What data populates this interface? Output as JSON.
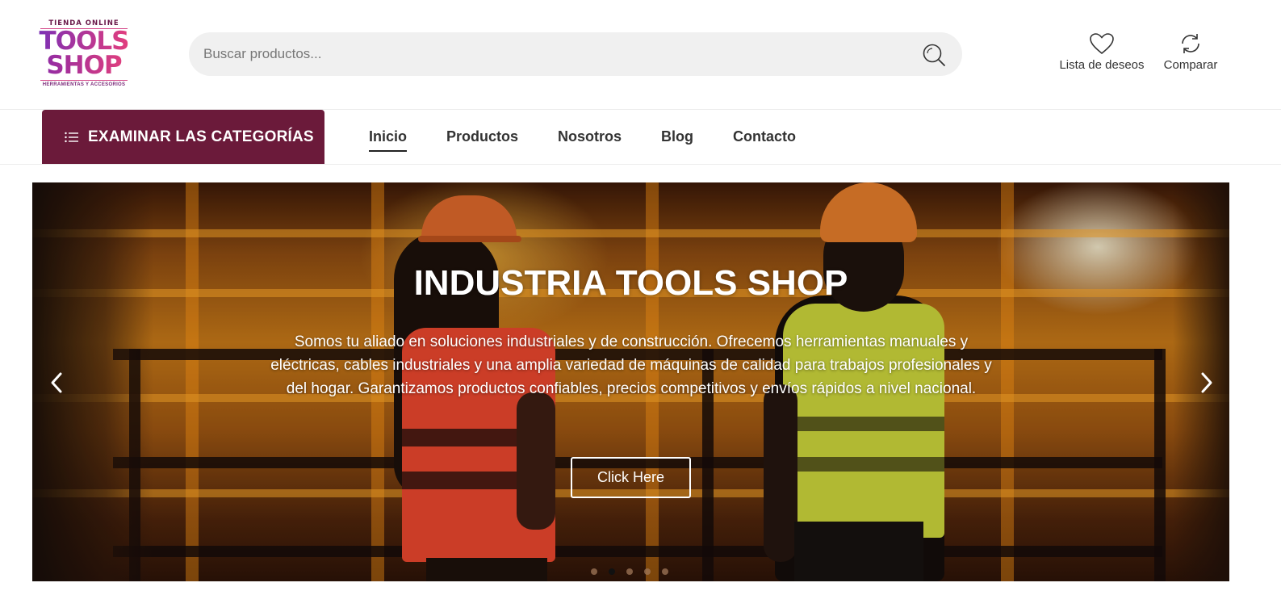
{
  "logo": {
    "tagline": "TIENDA ONLINE",
    "line1": "TOOLS",
    "line2": "SHOP",
    "subtitle": "HERRAMIENTAS Y ACCESORIOS"
  },
  "search": {
    "placeholder": "Buscar productos...",
    "value": ""
  },
  "header_actions": {
    "wishlist_label": "Lista de deseos",
    "compare_label": "Comparar"
  },
  "nav": {
    "categories_label": "EXAMINAR LAS CATEGORÍAS",
    "links": [
      {
        "label": "Inicio",
        "active": true
      },
      {
        "label": "Productos",
        "active": false
      },
      {
        "label": "Nosotros",
        "active": false
      },
      {
        "label": "Blog",
        "active": false
      },
      {
        "label": "Contacto",
        "active": false
      }
    ]
  },
  "hero": {
    "title": "INDUSTRIA TOOLS SHOP",
    "text": "Somos tu aliado en soluciones industriales y de construcción. Ofrecemos herramientas manuales y eléctricas, cables industriales y una amplia variedad de máquinas de calidad para trabajos profesionales y del hogar. Garantizamos productos confiables, precios competitivos y envíos rápidos a nivel nacional.",
    "button_label": "Click Here",
    "slide_count": 5,
    "active_slide": 2
  },
  "colors": {
    "category_button_bg": "#6b1a3a",
    "search_bg": "#f0f0f0",
    "logo_gradient_start": "#7b2fb5",
    "logo_gradient_end": "#e53e7c"
  },
  "icons": {
    "search": "search-icon",
    "wishlist": "heart-icon",
    "compare": "refresh-icon",
    "categories": "list-icon",
    "prev": "chevron-left-icon",
    "next": "chevron-right-icon"
  }
}
